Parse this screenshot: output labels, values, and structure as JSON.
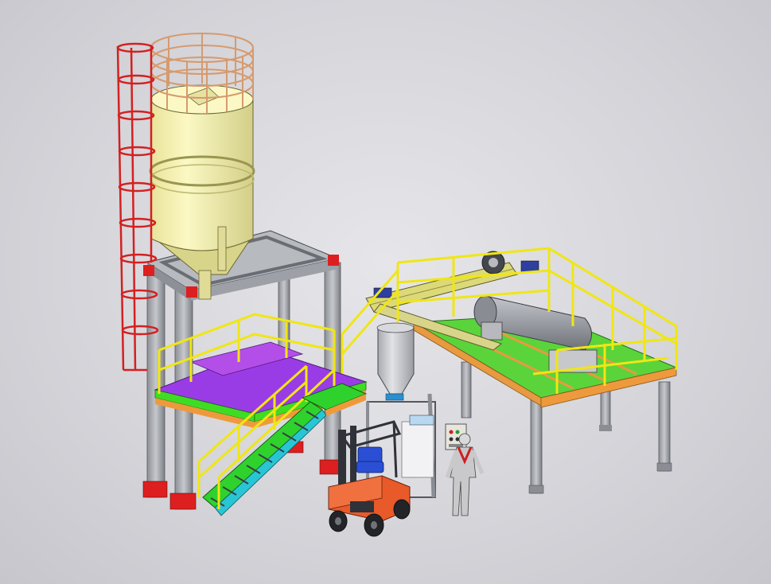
{
  "scene": {
    "description_hidden": "",
    "colors": {
      "background": "#d6d6db",
      "steel": "#a9acb3",
      "steel_dark": "#6f7278",
      "base_red": "#e01e1e",
      "silo_body": "#f4f1a8",
      "silo_shadow": "#d8d48a",
      "cage": "#d69a6e",
      "ladder": "#d42020",
      "handrail": "#f2ea12",
      "platform_green": "#3fdc24",
      "platform_orange": "#ee9a3c",
      "platform_purple": "#9a3ce6",
      "stair_green": "#2fd22c",
      "stair_cyan": "#28c6d4",
      "hopper": "#c9cbd0",
      "drum": "#9a9ca3",
      "forklift_orange": "#e85a2a",
      "forklift_dark": "#2f3238",
      "forklift_blue": "#2a4fd4",
      "control_box": "#e8e6dc",
      "worker_suit": "#c9c9cc",
      "worker_accent": "#cc2020"
    },
    "icons": [
      "silo-icon",
      "ladder-icon",
      "forklift-icon",
      "worker-icon",
      "control-panel-icon"
    ]
  }
}
